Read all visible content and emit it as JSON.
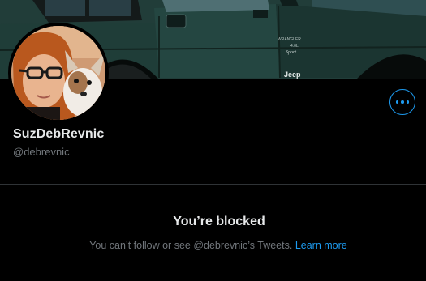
{
  "profile": {
    "display_name": "SuzDebRevnic",
    "handle": "@debrevnic",
    "banner": {
      "decal_brand": "WRANGLER",
      "decal_engine": "4.0L",
      "decal_trim": "Sport",
      "logo": "Jeep"
    },
    "more_button": {
      "icon": "ellipsis-icon"
    }
  },
  "blocked": {
    "title": "You’re blocked",
    "message": "You can’t follow or see @debrevnic’s Tweets.",
    "link_label": "Learn more"
  },
  "colors": {
    "background": "#000000",
    "accent": "#1d9bf0",
    "secondary_text": "#71767b",
    "primary_text": "#e7e9ea",
    "divider": "#2f3336"
  }
}
